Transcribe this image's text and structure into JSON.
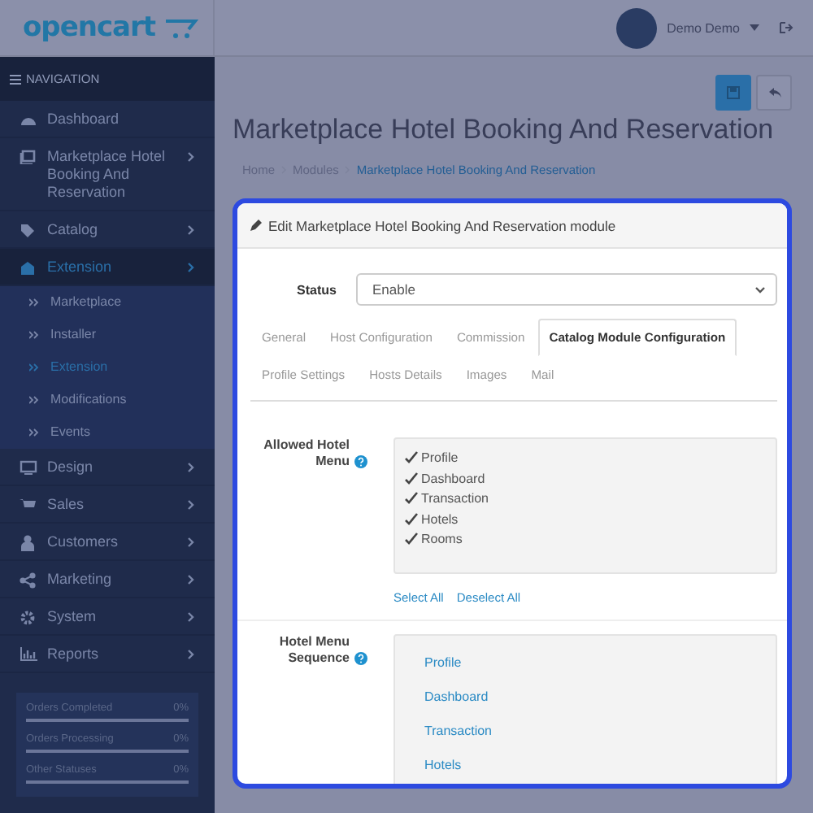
{
  "header": {
    "logo": "opencart",
    "user": "Demo Demo"
  },
  "sidebar": {
    "title": "NAVIGATION",
    "items": [
      {
        "label": "Dashboard",
        "expandable": false,
        "selected": false
      },
      {
        "label": "Marketplace Hotel Booking And Reservation",
        "expandable": true,
        "selected": false
      },
      {
        "label": "Catalog",
        "expandable": true,
        "selected": false
      },
      {
        "label": "Extension",
        "expandable": true,
        "selected": true,
        "children": [
          {
            "label": "Marketplace",
            "selected": false
          },
          {
            "label": "Installer",
            "selected": false
          },
          {
            "label": "Extension",
            "selected": true
          },
          {
            "label": "Modifications",
            "selected": false
          },
          {
            "label": "Events",
            "selected": false
          }
        ]
      },
      {
        "label": "Design",
        "expandable": true,
        "selected": false
      },
      {
        "label": "Sales",
        "expandable": true,
        "selected": false
      },
      {
        "label": "Customers",
        "expandable": true,
        "selected": false
      },
      {
        "label": "Marketing",
        "expandable": true,
        "selected": false
      },
      {
        "label": "System",
        "expandable": true,
        "selected": false
      },
      {
        "label": "Reports",
        "expandable": true,
        "selected": false
      }
    ],
    "stats": [
      {
        "label": "Orders Completed",
        "value": "0%",
        "level": 0
      },
      {
        "label": "Orders Processing",
        "value": "0%",
        "level": 0
      },
      {
        "label": "Other Statuses",
        "value": "0%",
        "level": 0
      }
    ]
  },
  "page": {
    "title": "Marketplace Hotel Booking And Reservation",
    "breadcrumb": [
      {
        "label": "Home",
        "selected": false
      },
      {
        "label": "Modules",
        "selected": false
      },
      {
        "label": "Marketplace Hotel Booking And Reservation",
        "selected": true
      }
    ]
  },
  "panel": {
    "heading": "Edit Marketplace Hotel Booking And Reservation module",
    "status": {
      "label": "Status",
      "value": "Enable"
    },
    "tabs": [
      {
        "label": "General",
        "selected": false
      },
      {
        "label": "Host Configuration",
        "selected": false
      },
      {
        "label": "Commission",
        "selected": false
      },
      {
        "label": "Catalog Module Configuration",
        "selected": true
      },
      {
        "label": "Profile Settings",
        "selected": false
      },
      {
        "label": "Hosts Details",
        "selected": false
      },
      {
        "label": "Images",
        "selected": false
      },
      {
        "label": "Mail",
        "selected": false
      }
    ],
    "allowed_menu": {
      "label": "Allowed Hotel Menu",
      "items": [
        {
          "label": "Profile",
          "checked": true
        },
        {
          "label": "Dashboard",
          "checked": true
        },
        {
          "label": "Transaction",
          "checked": true
        },
        {
          "label": "Hotels",
          "checked": true
        },
        {
          "label": "Rooms",
          "checked": true
        }
      ],
      "actions": [
        "Select All",
        "Deselect All"
      ]
    },
    "sequence": {
      "label": "Hotel Menu Sequence",
      "items": [
        "Profile",
        "Dashboard",
        "Transaction",
        "Hotels"
      ]
    }
  }
}
